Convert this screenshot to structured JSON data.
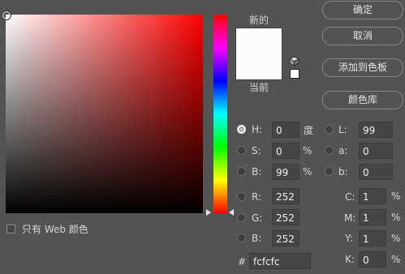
{
  "swatches": {
    "new_label": "新的",
    "current_label": "当前",
    "new_color": "#fcfcfc",
    "current_color": "#fcfcfc"
  },
  "buttons": {
    "ok": "确定",
    "cancel": "取消",
    "add_to_swatches": "添加到色板",
    "color_libraries": "颜色库"
  },
  "hsb": {
    "h_label": "H:",
    "h_value": "0",
    "h_unit": "度",
    "s_label": "S:",
    "s_value": "0",
    "s_unit": "%",
    "b_label": "B:",
    "b_value": "99",
    "b_unit": "%"
  },
  "lab": {
    "l_label": "L:",
    "l_value": "99",
    "a_label": "a:",
    "a_value": "0",
    "b_label": "b:",
    "b_value": "0"
  },
  "rgb": {
    "r_label": "R:",
    "r_value": "252",
    "g_label": "G:",
    "g_value": "252",
    "b_label": "B:",
    "b_value": "252"
  },
  "cmyk": {
    "c_label": "C:",
    "c_value": "1",
    "c_unit": "%",
    "m_label": "M:",
    "m_value": "1",
    "m_unit": "%",
    "y_label": "Y:",
    "y_value": "1",
    "y_unit": "%",
    "k_label": "K:",
    "k_value": "0",
    "k_unit": "%"
  },
  "hex": {
    "label": "#",
    "value": "fcfcfc"
  },
  "web_colors_label": "只有 Web 颜色",
  "icons": {
    "gamut": "cube-icon",
    "hue_pointer": "triangle-arrow"
  },
  "colors": {
    "hue_base": "#ff0000",
    "background": "#535353"
  }
}
